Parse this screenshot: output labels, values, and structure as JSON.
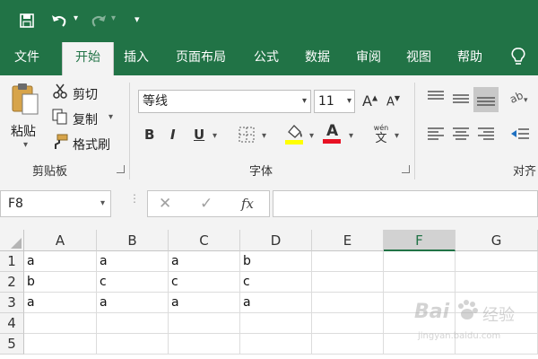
{
  "quick_access": {
    "save_icon": "save-icon",
    "undo_icon": "undo-icon",
    "redo_icon": "redo-icon",
    "customize_icon": "customize-icon"
  },
  "menu": {
    "tabs": [
      "文件",
      "开始",
      "插入",
      "页面布局",
      "公式",
      "数据",
      "审阅",
      "视图",
      "帮助"
    ],
    "active_tab": "开始",
    "help_icon": "lightbulb-icon"
  },
  "ribbon": {
    "clipboard": {
      "paste": "粘贴",
      "cut": "剪切",
      "copy": "复制",
      "format_painter": "格式刷",
      "group_label": "剪贴板"
    },
    "font": {
      "font_name": "等线",
      "font_size": "11",
      "grow_icon": "A",
      "shrink_icon": "A",
      "bold": "B",
      "italic": "I",
      "underline": "U",
      "font_color_letter": "A",
      "phonetic": "wén",
      "group_label": "字体"
    },
    "alignment": {
      "group_label": "对齐"
    }
  },
  "formula_bar": {
    "name_box": "F8",
    "cancel": "✕",
    "enter": "✓",
    "fx": "fx",
    "formula": ""
  },
  "sheet": {
    "columns": [
      "A",
      "B",
      "C",
      "D",
      "E",
      "F",
      "G"
    ],
    "selected_column": "F",
    "rows": [
      {
        "num": "1",
        "cells": [
          "a",
          "a",
          "a",
          "b",
          "",
          "",
          ""
        ]
      },
      {
        "num": "2",
        "cells": [
          "b",
          "c",
          "c",
          "c",
          "",
          "",
          ""
        ]
      },
      {
        "num": "3",
        "cells": [
          "a",
          "a",
          "a",
          "a",
          "",
          "",
          ""
        ]
      },
      {
        "num": "4",
        "cells": [
          "",
          "",
          "",
          "",
          "",
          "",
          ""
        ]
      },
      {
        "num": "5",
        "cells": [
          "",
          "",
          "",
          "",
          "",
          "",
          ""
        ]
      }
    ]
  },
  "watermark": {
    "brand": "Bai",
    "cn": "经验",
    "url": "jingyan.baidu.com"
  },
  "colors": {
    "accent": "#217346",
    "font_color_bar": "#e81123",
    "highlight_bar": "#ffff00"
  }
}
